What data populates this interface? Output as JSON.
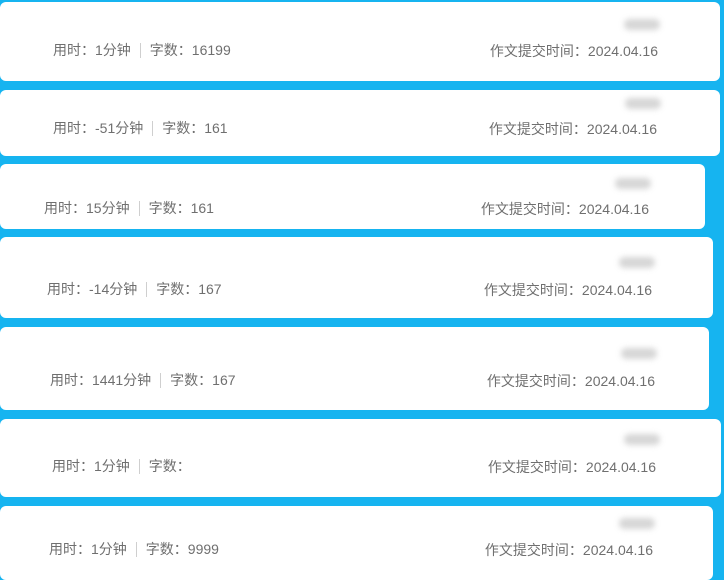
{
  "labels": {
    "time_prefix": "用时：",
    "words_prefix": "字数：",
    "submit_prefix": "作文提交时间："
  },
  "entries": [
    {
      "time": "1分钟",
      "words": "16199",
      "date": "2024.04.16"
    },
    {
      "time": "-51分钟",
      "words": "161",
      "date": "2024.04.16"
    },
    {
      "time": "15分钟",
      "words": "161",
      "date": "2024.04.16"
    },
    {
      "time": "-14分钟",
      "words": "167",
      "date": "2024.04.16"
    },
    {
      "time": "1441分钟",
      "words": "167",
      "date": "2024.04.16"
    },
    {
      "time": "1分钟",
      "words": "",
      "date": "2024.04.16"
    },
    {
      "time": "1分钟",
      "words": "9999",
      "date": "2024.04.16"
    }
  ],
  "colors": {
    "background": "#16b4f0",
    "card": "#ffffff",
    "text": "#6f6f6f"
  }
}
